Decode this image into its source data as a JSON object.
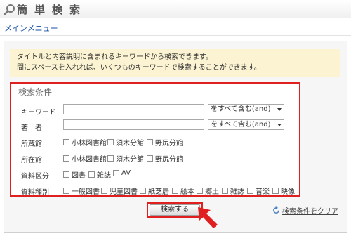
{
  "header": {
    "title": "簡単検索"
  },
  "nav": {
    "main_menu": "メインメニュー"
  },
  "notice": {
    "line1": "タイトルと内容説明に含まれるキーワードから検索できます。",
    "line2": "間にスペースを入れれば、いくつものキーワードで検索することができます。"
  },
  "conditions": {
    "title": "検索条件",
    "keyword": {
      "label": "キーワード",
      "value": "",
      "mode": "をすべて含む(and)"
    },
    "author": {
      "label": "著　者",
      "value": "",
      "mode": "をすべて含む(and)"
    },
    "holding_library": {
      "label": "所蔵館",
      "options": [
        "小林図書館",
        "須木分館",
        "野尻分館"
      ]
    },
    "location_library": {
      "label": "所在館",
      "options": [
        "小林図書館",
        "須木分館",
        "野尻分館"
      ]
    },
    "material_class": {
      "label": "資料区分",
      "options": [
        "図書",
        "雑誌",
        "AV"
      ]
    },
    "material_type": {
      "label": "資料種別",
      "options": [
        "一般図書",
        "児童図書",
        "紙芝居",
        "絵本",
        "郷土",
        "雑誌",
        "音楽",
        "映像"
      ]
    }
  },
  "actions": {
    "search_label": "検索する",
    "clear_label": "検索条件をクリア"
  },
  "colors": {
    "highlight": "#e02020",
    "notice_bg": "#fbf3d1",
    "link": "#1a4fa8"
  }
}
